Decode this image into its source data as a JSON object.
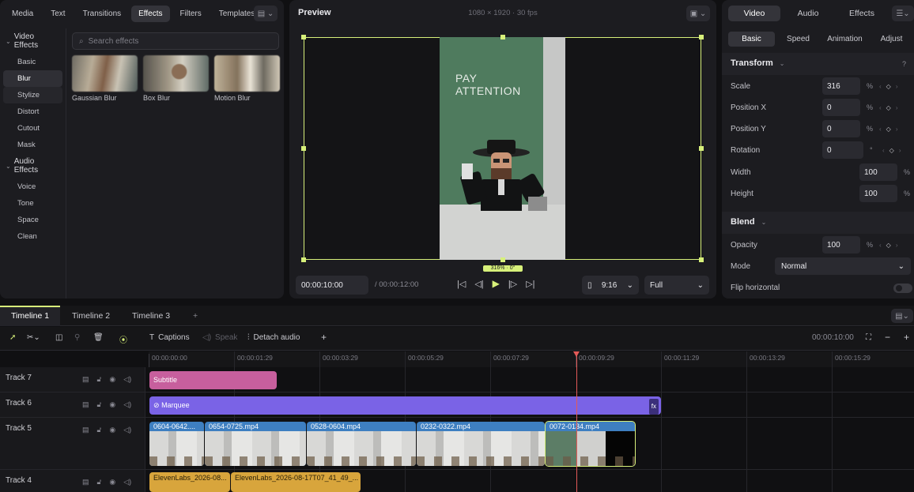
{
  "effects_panel": {
    "tabs": [
      {
        "label": "Media"
      },
      {
        "label": "Text"
      },
      {
        "label": "Transitions"
      },
      {
        "label": "Effects",
        "active": true
      },
      {
        "label": "Filters"
      },
      {
        "label": "Templates"
      }
    ],
    "categories": {
      "video_effects": "Video Effects",
      "video_items": [
        "Basic",
        "Blur",
        "Stylize",
        "Distort",
        "Cutout",
        "Mask"
      ],
      "video_active": "Blur",
      "audio_effects": "Audio Effects",
      "audio_items": [
        "Voice",
        "Tone",
        "Space",
        "Clean"
      ]
    },
    "search_placeholder": "Search effects",
    "effects": [
      "Gaussian Blur",
      "Box Blur",
      "Motion Blur"
    ]
  },
  "preview": {
    "title": "Preview",
    "resolution": "1080 × 1920 · 30 fps",
    "video_text_line1": "PAY",
    "video_text_line2": "ATTENTION",
    "zoom_tag": "316% · 0°",
    "current_time": "00:00:10:00",
    "duration": "/ 00:00:12:00",
    "aspect": "9:16",
    "quality": "Full"
  },
  "inspector": {
    "tabs": [
      "Video",
      "Audio",
      "Effects"
    ],
    "active_tab": "Video",
    "subtabs": [
      "Basic",
      "Speed",
      "Animation",
      "Adjust"
    ],
    "active_subtab": "Basic",
    "transform_title": "Transform",
    "help": "?",
    "scale_label": "Scale",
    "scale_value": "316",
    "scale_unit": "%",
    "posx_label": "Position X",
    "posx_value": "0",
    "posx_unit": "%",
    "posy_label": "Position Y",
    "posy_value": "0",
    "posy_unit": "%",
    "rotation_label": "Rotation",
    "rotation_value": "0",
    "rotation_unit": "°",
    "width_label": "Width",
    "width_value": "100",
    "width_unit": "%",
    "height_label": "Height",
    "height_value": "100",
    "height_unit": "%",
    "blend_title": "Blend",
    "opacity_label": "Opacity",
    "opacity_value": "100",
    "opacity_unit": "%",
    "mode_label": "Mode",
    "mode_value": "Normal",
    "flip_label": "Flip horizontal"
  },
  "timeline": {
    "tabs": [
      "Timeline 1",
      "Timeline 2",
      "Timeline 3"
    ],
    "active_tab": "Timeline 1",
    "add_tab": "+",
    "toolbar": {
      "captions": "Captions",
      "speak": "Speak",
      "detach_audio": "Detach audio",
      "add": "+",
      "time": "00:00:10:00",
      "zoom_out": "−",
      "zoom_in": "+"
    },
    "ruler": [
      "00:00:00:00",
      "00:00:01:29",
      "00:00:03:29",
      "00:00:05:29",
      "00:00:07:29",
      "00:00:09:29",
      "00:00:11:29",
      "00:00:13:29",
      "00:00:15:29"
    ],
    "tracks": [
      {
        "name": "Track 7"
      },
      {
        "name": "Track 6"
      },
      {
        "name": "Track 5"
      },
      {
        "name": "Track 4"
      }
    ],
    "clips": {
      "subtitle": "Subtitle",
      "marquee": "Marquee",
      "marquee_fx": "fx",
      "video": [
        "0604-0642....",
        "0654-0725.mp4",
        "0528-0604.mp4",
        "0232-0322.mp4",
        "0072-0134.mp4"
      ],
      "audio": [
        "ElevenLabs_2026-08...",
        "ElevenLabs_2026-08-17T07_41_49_..."
      ]
    }
  },
  "colors": {
    "accent": "#d7f07a",
    "playhead": "#e35a58",
    "subtitle_clip": "#c75f9d",
    "marquee_clip": "#7a63e6",
    "video_clip": "#3e7fc1",
    "audio_clip": "#d8a53c"
  }
}
